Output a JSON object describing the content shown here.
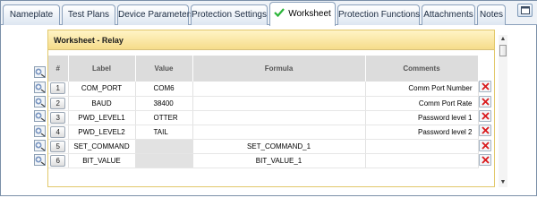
{
  "tabs": [
    {
      "label": "Nameplate"
    },
    {
      "label": "Test Plans"
    },
    {
      "label": "Device Parameters"
    },
    {
      "label": "Protection Settings"
    },
    {
      "label": "Worksheet",
      "active": true
    },
    {
      "label": "Protection Functions"
    },
    {
      "label": "Attachments"
    },
    {
      "label": "Notes"
    }
  ],
  "worksheet": {
    "title": "Worksheet - Relay",
    "columns": [
      "#",
      "Label",
      "Value",
      "Formula",
      "Comments"
    ],
    "rows": [
      {
        "num": "1",
        "label": "COM_PORT",
        "value": "COM6",
        "formula": "",
        "comments": "Comm Port Number"
      },
      {
        "num": "2",
        "label": "BAUD",
        "value": "38400",
        "formula": "",
        "comments": "Comm Port Rate"
      },
      {
        "num": "3",
        "label": "PWD_LEVEL1",
        "value": "OTTER",
        "formula": "",
        "comments": "Password level 1"
      },
      {
        "num": "4",
        "label": "PWD_LEVEL2",
        "value": "TAIL",
        "formula": "",
        "comments": "Password level 2"
      },
      {
        "num": "5",
        "label": "SET_COMMAND",
        "value": "",
        "formula": "SET_COMMAND_1",
        "comments": ""
      },
      {
        "num": "6",
        "label": "BIT_VALUE",
        "value": "",
        "formula": "BIT_VALUE_1",
        "comments": ""
      }
    ]
  },
  "icons": {
    "add_row": "add-row-icon",
    "delete_row": "delete-x-icon",
    "tab_check": "check-icon",
    "window_button": "window-icon"
  },
  "colors": {
    "panel_header": "#f6dc8a",
    "delete_x": "#d9191c",
    "tab_border": "#8aa0bb"
  }
}
